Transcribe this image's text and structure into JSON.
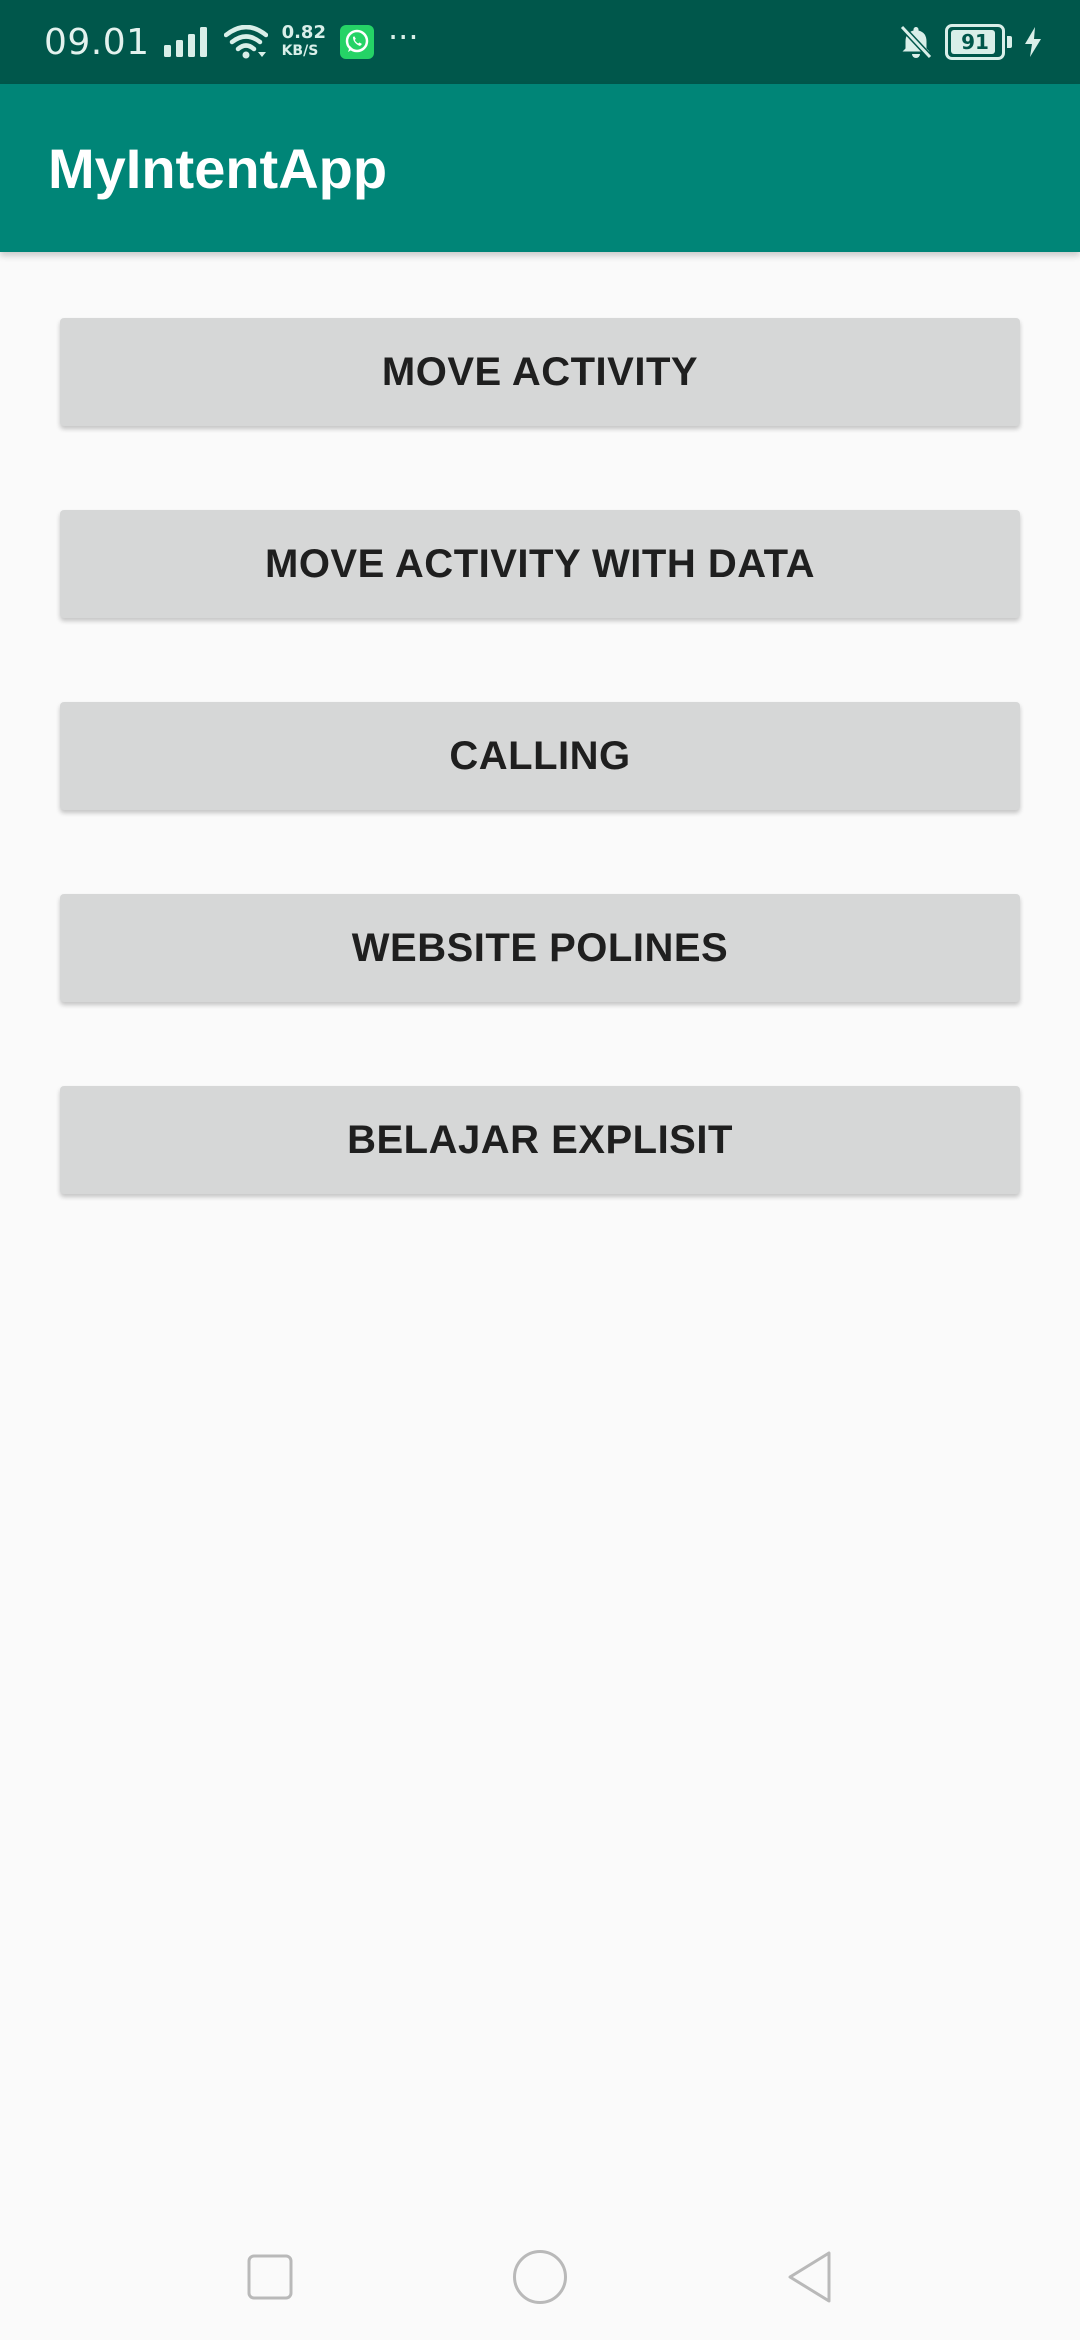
{
  "status_bar": {
    "time": "09.01",
    "net_speed_value": "0.82",
    "net_speed_unit": "KB/S",
    "overflow": "···",
    "battery_level": "91",
    "battery_fraction": 0.91,
    "colors": {
      "background": "#00574b",
      "icon": "#d9efe9"
    },
    "icons": [
      "signal-icon",
      "wifi-icon",
      "whatsapp-icon",
      "notifications-off-icon",
      "battery-icon",
      "charging-icon"
    ]
  },
  "app_bar": {
    "title": "MyIntentApp",
    "color": "#008577"
  },
  "buttons": [
    {
      "label": "MOVE ACTIVITY"
    },
    {
      "label": "MOVE ACTIVITY WITH DATA"
    },
    {
      "label": "CALLING"
    },
    {
      "label": "WEBSITE POLINES"
    },
    {
      "label": "BELAJAR EXPLISIT"
    }
  ],
  "nav_bar": {
    "icons": [
      "recents-square-icon",
      "home-circle-icon",
      "back-triangle-icon"
    ]
  }
}
